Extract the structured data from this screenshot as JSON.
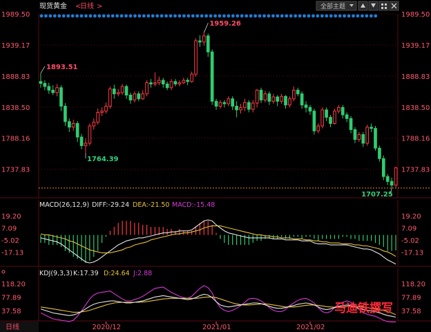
{
  "header": {
    "title": "现货黄金",
    "period": "日线",
    "theme_button": "全部主题",
    "icons": [
      "arrow-up-icon",
      "arrow-down-icon",
      "grid-icon",
      "close-icon"
    ]
  },
  "panes": {
    "macd": {
      "label": "MACD(26,12,9)",
      "diff": "DIFF:-29.24",
      "dea": "DEA:-21.50",
      "macd": "MACD:-15.48"
    },
    "kdj": {
      "label": "KDJ(9,3,3)",
      "k": "K:17.39",
      "d": "D:24.64",
      "j": "J:2.88"
    }
  },
  "footer": {
    "period_tab": "日线"
  },
  "watermark": "马迪铁撰写",
  "colors": {
    "bg": "#000000",
    "up": "#ff3b45",
    "down": "#2ecc71",
    "axis": "#ff5a6e",
    "grid": "#5a0d14",
    "diff": "#e8e8e8",
    "dea": "#e8c33a",
    "macd": "#d63bd6",
    "ref": "#e38a1e",
    "dots": "#1e7fd6",
    "label_red": "#ff4d6a",
    "label_green": "#35d07f"
  },
  "chart_data": [
    {
      "type": "candlestick",
      "name": "现货黄金 日线",
      "price_axis_ticks": [
        1989.5,
        1939.17,
        1888.83,
        1838.5,
        1788.16,
        1737.83
      ],
      "price_axis_ticks_text": [
        "1989.50",
        "1939.17",
        "1888.83",
        "1838.50",
        "1788.16",
        "1737.83"
      ],
      "ylim": [
        1706,
        1992
      ],
      "x_labels": [
        {
          "label": "2020/12",
          "index": 16
        },
        {
          "label": "2021/01",
          "index": 43
        },
        {
          "label": "2021/02",
          "index": 66
        }
      ],
      "annotations": [
        {
          "text": "1893.51",
          "index": 0,
          "value": 1893.51
        },
        {
          "text": "1764.39",
          "index": 11,
          "value": 1764.39
        },
        {
          "text": "1959.26",
          "index": 40,
          "value": 1959.26
        },
        {
          "text": "1707.25",
          "index": 86,
          "value": 1707.25
        }
      ],
      "reference_line": 1707.25,
      "candles": [
        [
          1880,
          1877,
          1893.51,
          1870
        ],
        [
          1877,
          1872,
          1882,
          1866
        ],
        [
          1872,
          1866,
          1878,
          1860
        ],
        [
          1866,
          1862,
          1874,
          1858
        ],
        [
          1862,
          1870,
          1876,
          1856
        ],
        [
          1870,
          1840,
          1874,
          1832
        ],
        [
          1840,
          1815,
          1845,
          1808
        ],
        [
          1815,
          1806,
          1820,
          1798
        ],
        [
          1806,
          1812,
          1818,
          1800
        ],
        [
          1812,
          1790,
          1816,
          1782
        ],
        [
          1790,
          1776,
          1795,
          1770
        ],
        [
          1776,
          1780,
          1788,
          1764.39
        ],
        [
          1780,
          1808,
          1812,
          1776
        ],
        [
          1808,
          1814,
          1820,
          1802
        ],
        [
          1814,
          1830,
          1836,
          1810
        ],
        [
          1830,
          1832,
          1838,
          1824
        ],
        [
          1832,
          1840,
          1846,
          1828
        ],
        [
          1840,
          1868,
          1872,
          1836
        ],
        [
          1868,
          1860,
          1875,
          1852
        ],
        [
          1860,
          1862,
          1868,
          1856
        ],
        [
          1862,
          1872,
          1876,
          1858
        ],
        [
          1872,
          1858,
          1875,
          1852
        ],
        [
          1858,
          1850,
          1862,
          1844
        ],
        [
          1850,
          1860,
          1864,
          1846
        ],
        [
          1860,
          1852,
          1864,
          1848
        ],
        [
          1852,
          1860,
          1866,
          1850
        ],
        [
          1860,
          1878,
          1882,
          1856
        ],
        [
          1878,
          1876,
          1884,
          1870
        ],
        [
          1876,
          1878,
          1895,
          1872
        ],
        [
          1878,
          1882,
          1888,
          1874
        ],
        [
          1882,
          1876,
          1886,
          1870
        ],
        [
          1876,
          1870,
          1880,
          1866
        ],
        [
          1870,
          1880,
          1884,
          1866
        ],
        [
          1880,
          1876,
          1884,
          1872
        ],
        [
          1876,
          1878,
          1882,
          1872
        ],
        [
          1878,
          1882,
          1886,
          1876
        ],
        [
          1882,
          1880,
          1886,
          1874
        ],
        [
          1880,
          1892,
          1896,
          1878
        ],
        [
          1892,
          1946,
          1950,
          1888
        ],
        [
          1946,
          1944,
          1955,
          1936
        ],
        [
          1944,
          1954,
          1959.26,
          1938
        ],
        [
          1954,
          1928,
          1958,
          1920
        ],
        [
          1928,
          1848,
          1932,
          1842
        ],
        [
          1848,
          1840,
          1852,
          1834
        ],
        [
          1840,
          1846,
          1850,
          1836
        ],
        [
          1846,
          1844,
          1850,
          1838
        ],
        [
          1844,
          1852,
          1856,
          1840
        ],
        [
          1852,
          1840,
          1856,
          1834
        ],
        [
          1840,
          1834,
          1848,
          1822
        ],
        [
          1834,
          1838,
          1844,
          1828
        ],
        [
          1838,
          1846,
          1852,
          1832
        ],
        [
          1846,
          1835,
          1850,
          1830
        ],
        [
          1835,
          1845,
          1850,
          1830
        ],
        [
          1845,
          1866,
          1868,
          1838
        ],
        [
          1866,
          1850,
          1870,
          1845
        ],
        [
          1850,
          1860,
          1865,
          1846
        ],
        [
          1860,
          1848,
          1864,
          1842
        ],
        [
          1848,
          1855,
          1860,
          1844
        ],
        [
          1855,
          1848,
          1858,
          1840
        ],
        [
          1848,
          1856,
          1860,
          1844
        ],
        [
          1856,
          1842,
          1858,
          1836
        ],
        [
          1842,
          1852,
          1856,
          1838
        ],
        [
          1852,
          1866,
          1872,
          1848
        ],
        [
          1866,
          1860,
          1870,
          1856
        ],
        [
          1860,
          1842,
          1864,
          1836
        ],
        [
          1842,
          1838,
          1848,
          1830
        ],
        [
          1838,
          1832,
          1842,
          1826
        ],
        [
          1832,
          1800,
          1836,
          1794
        ],
        [
          1800,
          1808,
          1812,
          1796
        ],
        [
          1808,
          1834,
          1838,
          1804
        ],
        [
          1834,
          1822,
          1838,
          1816
        ],
        [
          1822,
          1812,
          1826,
          1806
        ],
        [
          1812,
          1832,
          1836,
          1810
        ],
        [
          1832,
          1838,
          1842,
          1828
        ],
        [
          1838,
          1826,
          1842,
          1820
        ],
        [
          1826,
          1820,
          1830,
          1814
        ],
        [
          1820,
          1802,
          1824,
          1796
        ],
        [
          1802,
          1786,
          1806,
          1780
        ],
        [
          1786,
          1794,
          1798,
          1782
        ],
        [
          1794,
          1780,
          1798,
          1774
        ],
        [
          1780,
          1806,
          1810,
          1776
        ],
        [
          1806,
          1804,
          1812,
          1798
        ],
        [
          1804,
          1772,
          1808,
          1768
        ],
        [
          1772,
          1755,
          1776,
          1750
        ],
        [
          1755,
          1726,
          1760,
          1720
        ],
        [
          1726,
          1718,
          1730,
          1712
        ],
        [
          1718,
          1712,
          1724,
          1707.25
        ],
        [
          1712,
          1740,
          1742,
          1708
        ]
      ]
    },
    {
      "type": "macd",
      "name": "MACD(26,12,9)",
      "y_ticks": [
        19.2,
        7.09,
        -5.02,
        -17.13
      ],
      "y_ticks_text": [
        "19.20",
        "7.09",
        "-5.02",
        "-17.13"
      ],
      "ylim": [
        -30,
        26
      ],
      "diff": [
        -3,
        -4,
        -5,
        -6,
        -7,
        -9,
        -12,
        -15,
        -18,
        -21,
        -24,
        -27,
        -28,
        -27,
        -25,
        -22,
        -19,
        -16,
        -13,
        -10,
        -8,
        -6,
        -5,
        -4,
        -3,
        -3,
        -2,
        -1,
        0,
        1,
        2,
        2,
        3,
        3,
        4,
        4,
        4,
        5,
        8,
        11,
        14,
        15,
        14,
        10,
        7,
        4,
        2,
        1,
        0,
        -1,
        -2,
        -3,
        -3,
        -3,
        -3,
        -3,
        -3,
        -4,
        -4,
        -4,
        -5,
        -5,
        -5,
        -5,
        -6,
        -6,
        -6,
        -8,
        -9,
        -9,
        -9,
        -10,
        -10,
        -10,
        -10,
        -10,
        -11,
        -12,
        -13,
        -14,
        -14,
        -15,
        -17,
        -19,
        -22,
        -25,
        -27,
        -29.24
      ],
      "dea": [
        1,
        0,
        0,
        -1,
        -2,
        -3,
        -4,
        -6,
        -7,
        -9,
        -11,
        -13,
        -15,
        -16,
        -17,
        -18,
        -18,
        -18,
        -17,
        -16,
        -15,
        -13,
        -12,
        -10,
        -9,
        -8,
        -7,
        -5,
        -4,
        -3,
        -2,
        -1,
        0,
        1,
        1,
        2,
        2,
        3,
        4,
        5,
        7,
        8,
        9,
        9,
        9,
        8,
        7,
        6,
        5,
        4,
        3,
        2,
        1,
        0,
        0,
        -1,
        -1,
        -2,
        -2,
        -3,
        -3,
        -3,
        -4,
        -4,
        -4,
        -5,
        -5,
        -6,
        -6,
        -7,
        -7,
        -8,
        -8,
        -8,
        -9,
        -9,
        -9,
        -10,
        -10,
        -11,
        -11,
        -12,
        -13,
        -14,
        -16,
        -17,
        -19,
        -21.5
      ]
    },
    {
      "type": "kdj",
      "name": "KDJ(9,3,3)",
      "y_ticks": [
        118.2,
        77.89,
        37.58
      ],
      "y_ticks_text": [
        "118.20",
        "77.89",
        "37.58"
      ],
      "ylim": [
        10,
        135
      ],
      "k": [
        42,
        38,
        34,
        30,
        28,
        26,
        24,
        22,
        24,
        28,
        34,
        42,
        50,
        56,
        60,
        62,
        64,
        66,
        66,
        64,
        62,
        60,
        60,
        62,
        64,
        66,
        70,
        74,
        78,
        80,
        82,
        80,
        78,
        76,
        74,
        72,
        70,
        72,
        76,
        82,
        86,
        84,
        76,
        64,
        54,
        50,
        48,
        50,
        52,
        54,
        56,
        58,
        60,
        60,
        58,
        54,
        50,
        46,
        44,
        44,
        46,
        50,
        52,
        56,
        58,
        60,
        58,
        54,
        48,
        42,
        40,
        42,
        46,
        50,
        52,
        54,
        52,
        48,
        44,
        40,
        38,
        36,
        34,
        30,
        26,
        22,
        20,
        17.39
      ],
      "d": [
        48,
        46,
        44,
        42,
        40,
        38,
        36,
        34,
        32,
        32,
        33,
        35,
        38,
        42,
        46,
        50,
        54,
        57,
        60,
        61,
        62,
        62,
        62,
        62,
        62,
        63,
        64,
        66,
        68,
        70,
        72,
        73,
        74,
        74,
        74,
        74,
        74,
        74,
        74,
        75,
        77,
        78,
        78,
        76,
        72,
        68,
        64,
        60,
        57,
        55,
        54,
        54,
        55,
        56,
        57,
        57,
        56,
        54,
        52,
        50,
        48,
        48,
        48,
        49,
        51,
        53,
        54,
        54,
        53,
        51,
        49,
        48,
        47,
        47,
        48,
        49,
        50,
        50,
        49,
        48,
        46,
        44,
        42,
        40,
        37,
        34,
        30,
        24.64
      ],
      "j": [
        30,
        24,
        18,
        12,
        10,
        8,
        6,
        4,
        8,
        20,
        36,
        54,
        72,
        84,
        90,
        92,
        94,
        96,
        88,
        80,
        72,
        66,
        66,
        70,
        74,
        80,
        88,
        96,
        104,
        106,
        108,
        100,
        92,
        86,
        80,
        76,
        74,
        80,
        92,
        104,
        112,
        106,
        90,
        64,
        46,
        38,
        34,
        38,
        44,
        52,
        62,
        72,
        74,
        72,
        66,
        58,
        46,
        38,
        34,
        34,
        40,
        52,
        60,
        68,
        72,
        74,
        68,
        60,
        46,
        34,
        30,
        34,
        46,
        56,
        62,
        66,
        62,
        50,
        40,
        30,
        26,
        22,
        20,
        14,
        8,
        4,
        3,
        2.88
      ]
    }
  ]
}
